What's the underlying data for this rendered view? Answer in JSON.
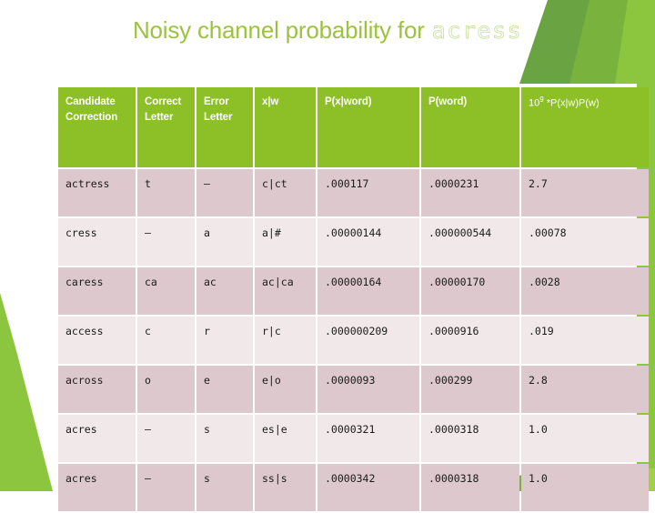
{
  "slide": {
    "title_main": "Noisy channel probability for",
    "title_term": "acress"
  },
  "theme": {
    "title_green": "#9dc23f",
    "title_term_outline": "#c6dd9a",
    "header_green": "#8cc026",
    "row_odd": "#ddc9cd",
    "row_even": "#f1e9e9",
    "deco_green_dark": "#6aa442",
    "deco_green_mid": "#79b23c",
    "deco_green_light": "#8cc63f",
    "deco_green_pale": "#a3cf4d",
    "background": "#ffffff"
  },
  "table": {
    "headers": [
      "Candidate Correction",
      "Correct Letter",
      "Error Letter",
      "x|w",
      "P(x|word)",
      "P(word)",
      "10⁹ *P(x|w)P(w)"
    ],
    "header_last_prefix": "10",
    "header_last_exponent": "9",
    "header_last_suffix": " *P(x|w)P(w)",
    "rows": [
      {
        "candidate": "actress",
        "correct_letter": "t",
        "error_letter": "–",
        "x_given_w": "c|ct",
        "p_x_word": ".000117",
        "p_word": ".0000231",
        "product": "2.7"
      },
      {
        "candidate": "cress",
        "correct_letter": "–",
        "error_letter": "a",
        "x_given_w": "a|#",
        "p_x_word": ".00000144",
        "p_word": ".000000544",
        "product": ".00078"
      },
      {
        "candidate": "caress",
        "correct_letter": "ca",
        "error_letter": "ac",
        "x_given_w": "ac|ca",
        "p_x_word": ".00000164",
        "p_word": ".00000170",
        "product": ".0028"
      },
      {
        "candidate": "access",
        "correct_letter": "c",
        "error_letter": "r",
        "x_given_w": "r|c",
        "p_x_word": ".000000209",
        "p_word": ".0000916",
        "product": ".019"
      },
      {
        "candidate": "across",
        "correct_letter": "o",
        "error_letter": "e",
        "x_given_w": "e|o",
        "p_x_word": ".0000093",
        "p_word": ".000299",
        "product": "2.8"
      },
      {
        "candidate": "acres",
        "correct_letter": "–",
        "error_letter": "s",
        "x_given_w": "es|e",
        "p_x_word": ".0000321",
        "p_word": ".0000318",
        "product": "1.0"
      },
      {
        "candidate": "acres",
        "correct_letter": "–",
        "error_letter": "s",
        "x_given_w": "ss|s",
        "p_x_word": ".0000342",
        "p_word": ".0000318",
        "product": "1.0"
      }
    ]
  }
}
